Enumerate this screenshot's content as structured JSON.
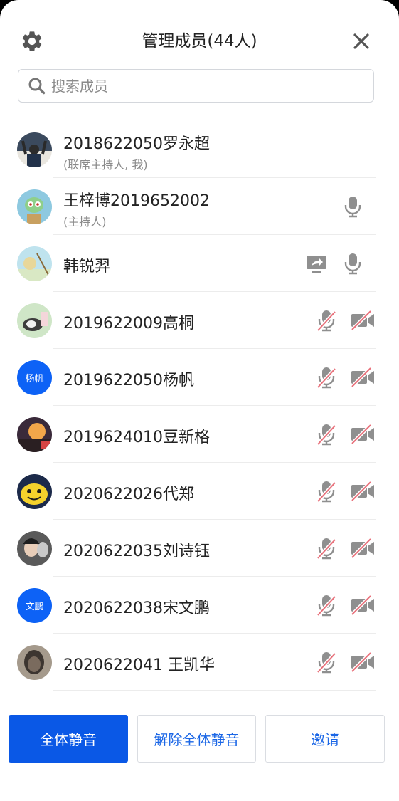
{
  "header": {
    "title": "管理成员(44人)"
  },
  "search": {
    "placeholder": "搜索成员"
  },
  "members": [
    {
      "name": "2018622050罗永超",
      "role": "(联席主持人, 我)",
      "avatar_type": "photo",
      "avatar_colors": [
        "#3b4a5e",
        "#e9e6df"
      ],
      "share": false,
      "audio": "none",
      "video": "none"
    },
    {
      "name": "王梓博2019652002",
      "role": "(主持人)",
      "avatar_type": "photo",
      "avatar_colors": [
        "#8ec9e0",
        "#6fae72"
      ],
      "share": false,
      "audio": "on",
      "video": "none"
    },
    {
      "name": "韩锐羿",
      "role": "",
      "avatar_type": "photo",
      "avatar_colors": [
        "#bfe3ee",
        "#d9e8c4"
      ],
      "share": true,
      "audio": "on",
      "video": "none"
    },
    {
      "name": "2019622009高桐",
      "role": "",
      "avatar_type": "photo",
      "avatar_colors": [
        "#cfe6c7",
        "#3d3d3d"
      ],
      "share": false,
      "audio": "muted",
      "video": "off"
    },
    {
      "name": "2019622050杨帆",
      "role": "",
      "avatar_type": "text",
      "avatar_text": "杨帆",
      "share": false,
      "audio": "muted",
      "video": "off"
    },
    {
      "name": "2019624010豆新格",
      "role": "",
      "avatar_type": "photo",
      "avatar_colors": [
        "#3a2a3a",
        "#f2a64a"
      ],
      "share": false,
      "audio": "muted",
      "video": "off"
    },
    {
      "name": "2020622026代郑",
      "role": "",
      "avatar_type": "photo",
      "avatar_colors": [
        "#f5d22c",
        "#1c2a4a"
      ],
      "share": false,
      "audio": "muted",
      "video": "off"
    },
    {
      "name": "2020622035刘诗钰",
      "role": "",
      "avatar_type": "photo",
      "avatar_colors": [
        "#5a5a5a",
        "#c9c9c9"
      ],
      "share": false,
      "audio": "muted",
      "video": "off"
    },
    {
      "name": "2020622038宋文鹏",
      "role": "",
      "avatar_type": "text",
      "avatar_text": "文鹏",
      "share": false,
      "audio": "muted",
      "video": "off"
    },
    {
      "name": "2020622041 王凯华",
      "role": "",
      "avatar_type": "photo",
      "avatar_colors": [
        "#3c3530",
        "#a59a8c"
      ],
      "share": false,
      "audio": "muted",
      "video": "off"
    }
  ],
  "footer": {
    "mute_all": "全体静音",
    "unmute_all": "解除全体静音",
    "invite": "邀请"
  },
  "colors": {
    "primary": "#0a58e6",
    "link_text": "#1a66e6",
    "muted_slash": "#e8707a",
    "icon_gray": "#8f8f8f"
  },
  "icons": {
    "settings": "gear-icon",
    "close": "close-icon",
    "search": "search-icon",
    "audio_on": "microphone-icon",
    "audio_muted": "microphone-muted-icon",
    "video_off": "camera-off-icon",
    "share": "screen-share-icon"
  }
}
